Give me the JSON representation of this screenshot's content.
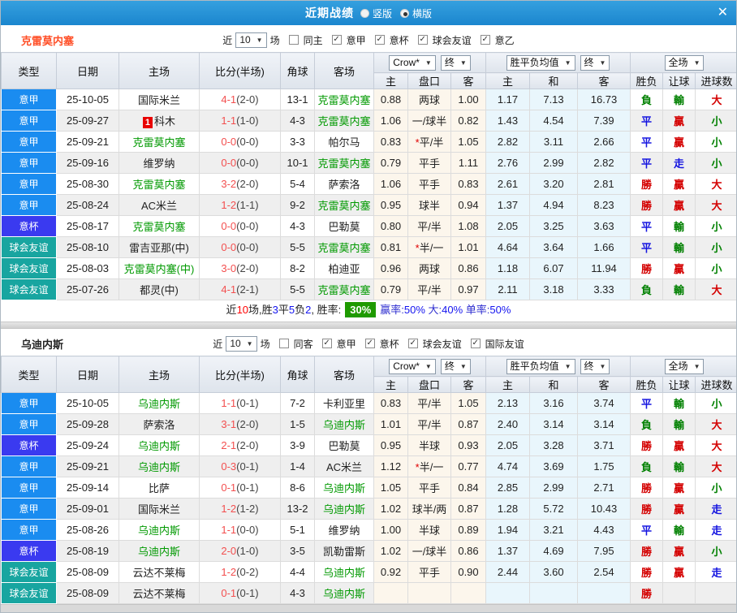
{
  "top_bar": {
    "title": "近期战绩",
    "radios": [
      {
        "label": "竖版",
        "selected": false
      },
      {
        "label": "横版",
        "selected": true
      }
    ]
  },
  "icons": {
    "caret": "▼",
    "check": "✓",
    "close": "✕"
  },
  "colors": {
    "top_bar": "#1E8FD6",
    "serie_a_badge": "#1A8CF0",
    "coppa_badge": "#3A3AF0",
    "friendly_badge": "#18A5A0",
    "focus_team_green": "#009900",
    "score_red": "#F34F4F",
    "win_red": "#D40000",
    "draw_blue": "#1414E0",
    "lose_green": "#008000",
    "team1_name": "#FF4E26",
    "win_rate_badge_bg": "#1E9A00",
    "handicap_col_bg": "#FCF6EC",
    "avg_col_bg": "#E9F6FC"
  },
  "table_headers": {
    "columns": [
      {
        "key": "type",
        "label": "类型"
      },
      {
        "key": "date",
        "label": "日期"
      },
      {
        "key": "home",
        "label": "主场"
      },
      {
        "key": "score",
        "label": "比分(半场)"
      },
      {
        "key": "corner",
        "label": "角球"
      },
      {
        "key": "away",
        "label": "客场"
      }
    ],
    "odds_source": "Crow*",
    "odds_stage": "终",
    "avg_label": "胜平负均值",
    "avg_stage": "终",
    "scope": "全场",
    "sub_headers": [
      "主",
      "盘口",
      "客",
      "主",
      "和",
      "客",
      "胜负",
      "让球",
      "进球数"
    ]
  },
  "sections": [
    {
      "team": "克雷莫内塞",
      "filter": {
        "near": "近",
        "count": "10",
        "games": "场",
        "same": "同主",
        "leagues": [
          "意甲",
          "意杯",
          "球会友谊",
          "意乙"
        ]
      },
      "rows": [
        {
          "t": "意甲",
          "c": "a",
          "d": "25-10-05",
          "hb": "",
          "h": "国际米兰",
          "hf": 0,
          "s": "4-1",
          "sh": "(2-0)",
          "cn": "13-1",
          "a": "克雷莫内塞",
          "af": 1,
          "o": [
            "0.88",
            "",
            "两球",
            "1.00"
          ],
          "m": [
            "1.17",
            "7.13",
            "16.73"
          ],
          "r": [
            [
              "負",
              "G"
            ],
            [
              "輸",
              "G"
            ],
            [
              "大",
              "R"
            ]
          ]
        },
        {
          "t": "意甲",
          "c": "a",
          "d": "25-09-27",
          "hb": "1",
          "h": "科木",
          "hf": 0,
          "s": "1-1",
          "sh": "(1-0)",
          "cn": "4-3",
          "a": "克雷莫内塞",
          "af": 1,
          "o": [
            "1.06",
            "",
            "一/球半",
            "0.82"
          ],
          "m": [
            "1.43",
            "4.54",
            "7.39"
          ],
          "r": [
            [
              "平",
              "B"
            ],
            [
              "贏",
              "R"
            ],
            [
              "小",
              "G"
            ]
          ]
        },
        {
          "t": "意甲",
          "c": "a",
          "d": "25-09-21",
          "hb": "",
          "h": "克雷莫内塞",
          "hf": 1,
          "s": "0-0",
          "sh": "(0-0)",
          "cn": "3-3",
          "a": "帕尔马",
          "af": 0,
          "o": [
            "0.83",
            "*",
            "平/半",
            "1.05"
          ],
          "m": [
            "2.82",
            "3.11",
            "2.66"
          ],
          "r": [
            [
              "平",
              "B"
            ],
            [
              "贏",
              "R"
            ],
            [
              "小",
              "G"
            ]
          ]
        },
        {
          "t": "意甲",
          "c": "a",
          "d": "25-09-16",
          "hb": "",
          "h": "维罗纳",
          "hf": 0,
          "s": "0-0",
          "sh": "(0-0)",
          "cn": "10-1",
          "a": "克雷莫内塞",
          "af": 1,
          "o": [
            "0.79",
            "",
            "平手",
            "1.11"
          ],
          "m": [
            "2.76",
            "2.99",
            "2.82"
          ],
          "r": [
            [
              "平",
              "B"
            ],
            [
              "走",
              "B"
            ],
            [
              "小",
              "G"
            ]
          ]
        },
        {
          "t": "意甲",
          "c": "a",
          "d": "25-08-30",
          "hb": "",
          "h": "克雷莫内塞",
          "hf": 1,
          "s": "3-2",
          "sh": "(2-0)",
          "cn": "5-4",
          "a": "萨索洛",
          "af": 0,
          "o": [
            "1.06",
            "",
            "平手",
            "0.83"
          ],
          "m": [
            "2.61",
            "3.20",
            "2.81"
          ],
          "r": [
            [
              "勝",
              "R"
            ],
            [
              "贏",
              "R"
            ],
            [
              "大",
              "R"
            ]
          ]
        },
        {
          "t": "意甲",
          "c": "a",
          "d": "25-08-24",
          "hb": "",
          "h": "AC米兰",
          "hf": 0,
          "s": "1-2",
          "sh": "(1-1)",
          "cn": "9-2",
          "a": "克雷莫内塞",
          "af": 1,
          "o": [
            "0.95",
            "",
            "球半",
            "0.94"
          ],
          "m": [
            "1.37",
            "4.94",
            "8.23"
          ],
          "r": [
            [
              "勝",
              "R"
            ],
            [
              "贏",
              "R"
            ],
            [
              "大",
              "R"
            ]
          ]
        },
        {
          "t": "意杯",
          "c": "cup",
          "d": "25-08-17",
          "hb": "",
          "h": "克雷莫内塞",
          "hf": 1,
          "s": "0-0",
          "sh": "(0-0)",
          "cn": "4-3",
          "a": "巴勒莫",
          "af": 0,
          "o": [
            "0.80",
            "",
            "平/半",
            "1.08"
          ],
          "m": [
            "2.05",
            "3.25",
            "3.63"
          ],
          "r": [
            [
              "平",
              "B"
            ],
            [
              "輸",
              "G"
            ],
            [
              "小",
              "G"
            ]
          ]
        },
        {
          "t": "球会友谊",
          "c": "fr",
          "d": "25-08-10",
          "hb": "",
          "h": "雷吉亚那(中)",
          "hf": 0,
          "s": "0-0",
          "sh": "(0-0)",
          "cn": "5-5",
          "a": "克雷莫内塞",
          "af": 1,
          "o": [
            "0.81",
            "*",
            "半/一",
            "1.01"
          ],
          "m": [
            "4.64",
            "3.64",
            "1.66"
          ],
          "r": [
            [
              "平",
              "B"
            ],
            [
              "輸",
              "G"
            ],
            [
              "小",
              "G"
            ]
          ]
        },
        {
          "t": "球会友谊",
          "c": "fr",
          "d": "25-08-03",
          "hb": "",
          "h": "克雷莫内塞(中)",
          "hf": 1,
          "s": "3-0",
          "sh": "(2-0)",
          "cn": "8-2",
          "a": "柏迪亚",
          "af": 0,
          "o": [
            "0.96",
            "",
            "两球",
            "0.86"
          ],
          "m": [
            "1.18",
            "6.07",
            "11.94"
          ],
          "r": [
            [
              "勝",
              "R"
            ],
            [
              "贏",
              "R"
            ],
            [
              "小",
              "G"
            ]
          ]
        },
        {
          "t": "球会友谊",
          "c": "fr",
          "d": "25-07-26",
          "hb": "",
          "h": "都灵(中)",
          "hf": 0,
          "s": "4-1",
          "sh": "(2-1)",
          "cn": "5-5",
          "a": "克雷莫内塞",
          "af": 1,
          "o": [
            "0.79",
            "",
            "平/半",
            "0.97"
          ],
          "m": [
            "2.11",
            "3.18",
            "3.33"
          ],
          "r": [
            [
              "負",
              "G"
            ],
            [
              "輸",
              "G"
            ],
            [
              "大",
              "R"
            ]
          ]
        }
      ],
      "summary": {
        "parts": [
          [
            "近",
            "k"
          ],
          [
            "10",
            "r"
          ],
          [
            "场,胜",
            "k"
          ],
          [
            "3",
            "b"
          ],
          [
            "平",
            "k"
          ],
          [
            "5",
            "b"
          ],
          [
            "负",
            "k"
          ],
          [
            "2",
            "b"
          ],
          [
            ", 胜率:",
            "k"
          ],
          [
            "30%",
            "badge"
          ],
          [
            "赢率:",
            "bl"
          ],
          [
            "50%",
            "b"
          ],
          [
            " 大:",
            "bl"
          ],
          [
            "40%",
            "b"
          ],
          [
            " 单率:",
            "bl"
          ],
          [
            "50%",
            "b"
          ]
        ]
      }
    },
    {
      "team": "乌迪内斯",
      "filter": {
        "near": "近",
        "count": "10",
        "games": "场",
        "same": "同客",
        "leagues": [
          "意甲",
          "意杯",
          "球会友谊",
          "国际友谊"
        ]
      },
      "rows": [
        {
          "t": "意甲",
          "c": "a",
          "d": "25-10-05",
          "hb": "",
          "h": "乌迪内斯",
          "hf": 1,
          "s": "1-1",
          "sh": "(0-1)",
          "cn": "7-2",
          "a": "卡利亚里",
          "af": 0,
          "o": [
            "0.83",
            "",
            "平/半",
            "1.05"
          ],
          "m": [
            "2.13",
            "3.16",
            "3.74"
          ],
          "r": [
            [
              "平",
              "B"
            ],
            [
              "輸",
              "G"
            ],
            [
              "小",
              "G"
            ]
          ]
        },
        {
          "t": "意甲",
          "c": "a",
          "d": "25-09-28",
          "hb": "",
          "h": "萨索洛",
          "hf": 0,
          "s": "3-1",
          "sh": "(2-0)",
          "cn": "1-5",
          "a": "乌迪内斯",
          "af": 1,
          "o": [
            "1.01",
            "",
            "平/半",
            "0.87"
          ],
          "m": [
            "2.40",
            "3.14",
            "3.14"
          ],
          "r": [
            [
              "負",
              "G"
            ],
            [
              "輸",
              "G"
            ],
            [
              "大",
              "R"
            ]
          ]
        },
        {
          "t": "意杯",
          "c": "cup",
          "d": "25-09-24",
          "hb": "",
          "h": "乌迪内斯",
          "hf": 1,
          "s": "2-1",
          "sh": "(2-0)",
          "cn": "3-9",
          "a": "巴勒莫",
          "af": 0,
          "o": [
            "0.95",
            "",
            "半球",
            "0.93"
          ],
          "m": [
            "2.05",
            "3.28",
            "3.71"
          ],
          "r": [
            [
              "勝",
              "R"
            ],
            [
              "贏",
              "R"
            ],
            [
              "大",
              "R"
            ]
          ]
        },
        {
          "t": "意甲",
          "c": "a",
          "d": "25-09-21",
          "hb": "",
          "h": "乌迪内斯",
          "hf": 1,
          "s": "0-3",
          "sh": "(0-1)",
          "cn": "1-4",
          "a": "AC米兰",
          "af": 0,
          "o": [
            "1.12",
            "*",
            "半/一",
            "0.77"
          ],
          "m": [
            "4.74",
            "3.69",
            "1.75"
          ],
          "r": [
            [
              "負",
              "G"
            ],
            [
              "輸",
              "G"
            ],
            [
              "大",
              "R"
            ]
          ]
        },
        {
          "t": "意甲",
          "c": "a",
          "d": "25-09-14",
          "hb": "",
          "h": "比萨",
          "hf": 0,
          "s": "0-1",
          "sh": "(0-1)",
          "cn": "8-6",
          "a": "乌迪内斯",
          "af": 1,
          "o": [
            "1.05",
            "",
            "平手",
            "0.84"
          ],
          "m": [
            "2.85",
            "2.99",
            "2.71"
          ],
          "r": [
            [
              "勝",
              "R"
            ],
            [
              "贏",
              "R"
            ],
            [
              "小",
              "G"
            ]
          ]
        },
        {
          "t": "意甲",
          "c": "a",
          "d": "25-09-01",
          "hb": "",
          "h": "国际米兰",
          "hf": 0,
          "s": "1-2",
          "sh": "(1-2)",
          "cn": "13-2",
          "a": "乌迪内斯",
          "af": 1,
          "o": [
            "1.02",
            "",
            "球半/两",
            "0.87"
          ],
          "m": [
            "1.28",
            "5.72",
            "10.43"
          ],
          "r": [
            [
              "勝",
              "R"
            ],
            [
              "贏",
              "R"
            ],
            [
              "走",
              "B"
            ]
          ]
        },
        {
          "t": "意甲",
          "c": "a",
          "d": "25-08-26",
          "hb": "",
          "h": "乌迪内斯",
          "hf": 1,
          "s": "1-1",
          "sh": "(0-0)",
          "cn": "5-1",
          "a": "维罗纳",
          "af": 0,
          "o": [
            "1.00",
            "",
            "半球",
            "0.89"
          ],
          "m": [
            "1.94",
            "3.21",
            "4.43"
          ],
          "r": [
            [
              "平",
              "B"
            ],
            [
              "輸",
              "G"
            ],
            [
              "走",
              "B"
            ]
          ]
        },
        {
          "t": "意杯",
          "c": "cup",
          "d": "25-08-19",
          "hb": "",
          "h": "乌迪内斯",
          "hf": 1,
          "s": "2-0",
          "sh": "(1-0)",
          "cn": "3-5",
          "a": "凯勒雷斯",
          "af": 0,
          "o": [
            "1.02",
            "",
            "一/球半",
            "0.86"
          ],
          "m": [
            "1.37",
            "4.69",
            "7.95"
          ],
          "r": [
            [
              "勝",
              "R"
            ],
            [
              "贏",
              "R"
            ],
            [
              "小",
              "G"
            ]
          ]
        },
        {
          "t": "球会友谊",
          "c": "fr",
          "d": "25-08-09",
          "hb": "",
          "h": "云达不莱梅",
          "hf": 0,
          "s": "1-2",
          "sh": "(0-2)",
          "cn": "4-4",
          "a": "乌迪内斯",
          "af": 1,
          "o": [
            "0.92",
            "",
            "平手",
            "0.90"
          ],
          "m": [
            "2.44",
            "3.60",
            "2.54"
          ],
          "r": [
            [
              "勝",
              "R"
            ],
            [
              "贏",
              "R"
            ],
            [
              "走",
              "B"
            ]
          ]
        },
        {
          "t": "球会友谊",
          "c": "fr",
          "d": "25-08-09",
          "hb": "",
          "h": "云达不莱梅",
          "hf": 0,
          "s": "0-1",
          "sh": "(0-1)",
          "cn": "4-3",
          "a": "乌迪内斯",
          "af": 1,
          "o": [
            "",
            "",
            "",
            ""
          ],
          "m": [
            "",
            "",
            ""
          ],
          "r": [
            [
              "勝",
              "R"
            ],
            [
              "",
              ""
            ],
            [
              "",
              ""
            ]
          ]
        }
      ],
      "summary": null
    }
  ]
}
